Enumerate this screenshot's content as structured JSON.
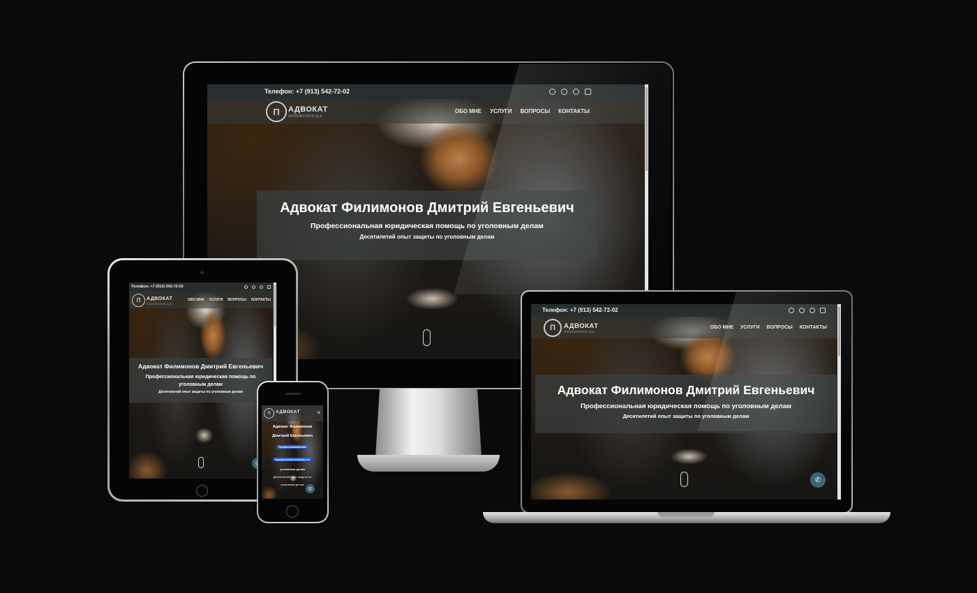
{
  "site": {
    "phone": "Телефон: +7 (913) 542-72-02",
    "logo_title": "АДВОКАТ",
    "logo_sub": "ФИЛИМОНОВ Д.Е.",
    "menu": [
      "ОБО МНЕ",
      "УСЛУГИ",
      "ВОПРОСЫ",
      "КОНТАКТЫ"
    ],
    "hero_title": "Адвокат Филимонов Дмитрий Евгеньевич",
    "hero_subtitle": "Профессиональная юридическая помощь по уголовным делам",
    "hero_desc": "Десятилетий опыт защиты по уголовным делам",
    "social_icons": [
      "whatsapp-icon",
      "viber-icon",
      "telegram-icon",
      "vk-icon"
    ]
  },
  "phone_view": {
    "logo_title": "АДВОКАТ",
    "hero_title_l1": "Адвокат Филимонов",
    "hero_title_l2": "Дмитрий Евгеньевич",
    "hero_sub_l1": "Профессиональная",
    "hero_sub_l2": "юридическая помощь по",
    "hero_sub_l3": "уголовным делам",
    "hero_desc_l1": "Десятилетий опыт защиты по",
    "hero_desc_l2": "уголовным делам"
  },
  "colors": {
    "background": "#0b0a0b",
    "topbar": "#282f32",
    "call_button": "#3b6473",
    "highlight": "#2563d9"
  }
}
